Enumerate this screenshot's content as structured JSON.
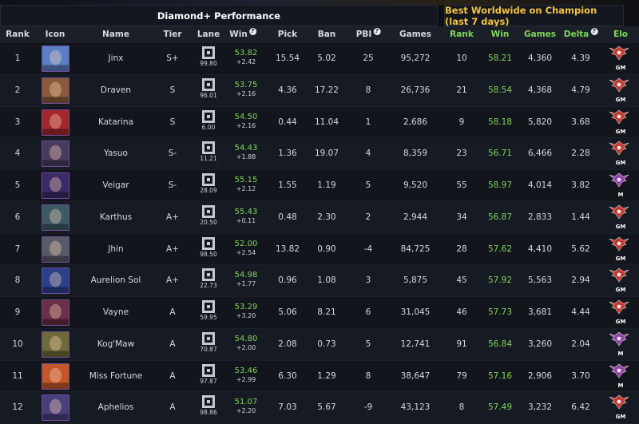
{
  "header": {
    "left_group": "Diamond+ Performance",
    "right_group": "Best Worldwide on Champion (last 7 days)"
  },
  "columns": {
    "rank": "Rank",
    "icon": "Icon",
    "name": "Name",
    "tier": "Tier",
    "lane": "Lane",
    "win": "Win",
    "pick": "Pick",
    "ban": "Ban",
    "pbi": "PBI",
    "games": "Games",
    "best_rank": "Rank",
    "best_win": "Win",
    "best_games": "Games",
    "delta": "Delta",
    "elo": "Elo"
  },
  "help_glyph": "?",
  "colors": {
    "accent_green": "#7fd65a",
    "gold": "#f4c542",
    "gm_red": "#c0392b",
    "m_purple": "#8e44ad"
  },
  "rows": [
    {
      "rank": "1",
      "name": "Jinx",
      "tier": "S+",
      "lane_val": "99.80",
      "win": "53.82",
      "win_delta": "+2.42",
      "pick": "15.54",
      "ban": "5.02",
      "pbi": "25",
      "games": "95,272",
      "best_rank": "10",
      "best_win": "58.21",
      "best_games": "4,360",
      "delta": "4.39",
      "elo": "GM",
      "portrait": "#5b7fc4"
    },
    {
      "rank": "2",
      "name": "Draven",
      "tier": "S",
      "lane_val": "96.01",
      "win": "53.75",
      "win_delta": "+2.16",
      "pick": "4.36",
      "ban": "17.22",
      "pbi": "8",
      "games": "26,736",
      "best_rank": "21",
      "best_win": "58.54",
      "best_games": "4,368",
      "delta": "4.79",
      "elo": "GM",
      "portrait": "#8a5a3a"
    },
    {
      "rank": "3",
      "name": "Katarina",
      "tier": "S",
      "lane_val": "6.00",
      "win": "54.50",
      "win_delta": "+2.16",
      "pick": "0.44",
      "ban": "11.04",
      "pbi": "1",
      "games": "2,686",
      "best_rank": "9",
      "best_win": "58.18",
      "best_games": "5,820",
      "delta": "3.68",
      "elo": "GM",
      "portrait": "#a3262a"
    },
    {
      "rank": "4",
      "name": "Yasuo",
      "tier": "S-",
      "lane_val": "11.21",
      "win": "54.43",
      "win_delta": "+1.88",
      "pick": "1.36",
      "ban": "19.07",
      "pbi": "4",
      "games": "8,359",
      "best_rank": "23",
      "best_win": "56.71",
      "best_games": "6,466",
      "delta": "2.28",
      "elo": "GM",
      "portrait": "#4a3b5e"
    },
    {
      "rank": "5",
      "name": "Veigar",
      "tier": "S-",
      "lane_val": "28.09",
      "win": "55.15",
      "win_delta": "+2.12",
      "pick": "1.55",
      "ban": "1.19",
      "pbi": "5",
      "games": "9,520",
      "best_rank": "55",
      "best_win": "58.97",
      "best_games": "4,014",
      "delta": "3.82",
      "elo": "M",
      "portrait": "#3b2a66"
    },
    {
      "rank": "6",
      "name": "Karthus",
      "tier": "A+",
      "lane_val": "20.50",
      "win": "55.43",
      "win_delta": "+0.11",
      "pick": "0.48",
      "ban": "2.30",
      "pbi": "2",
      "games": "2,944",
      "best_rank": "34",
      "best_win": "56.87",
      "best_games": "2,833",
      "delta": "1.44",
      "elo": "GM",
      "portrait": "#3d5963"
    },
    {
      "rank": "7",
      "name": "Jhin",
      "tier": "A+",
      "lane_val": "98.50",
      "win": "52.00",
      "win_delta": "+2.54",
      "pick": "13.82",
      "ban": "0.90",
      "pbi": "-4",
      "games": "84,725",
      "best_rank": "28",
      "best_win": "57.62",
      "best_games": "4,410",
      "delta": "5.62",
      "elo": "GM",
      "portrait": "#5a5a66"
    },
    {
      "rank": "8",
      "name": "Aurelion Sol",
      "tier": "A+",
      "lane_val": "22.73",
      "win": "54.98",
      "win_delta": "+1.77",
      "pick": "0.96",
      "ban": "1.08",
      "pbi": "3",
      "games": "5,875",
      "best_rank": "45",
      "best_win": "57.92",
      "best_games": "5,563",
      "delta": "2.94",
      "elo": "GM",
      "portrait": "#2c3f8a"
    },
    {
      "rank": "9",
      "name": "Vayne",
      "tier": "A",
      "lane_val": "59.95",
      "win": "53.29",
      "win_delta": "+3.20",
      "pick": "5.06",
      "ban": "8.21",
      "pbi": "6",
      "games": "31,045",
      "best_rank": "46",
      "best_win": "57.73",
      "best_games": "3,681",
      "delta": "4.44",
      "elo": "GM",
      "portrait": "#6b2f46"
    },
    {
      "rank": "10",
      "name": "Kog'Maw",
      "tier": "A",
      "lane_val": "70.87",
      "win": "54.80",
      "win_delta": "+2.00",
      "pick": "2.08",
      "ban": "0.73",
      "pbi": "5",
      "games": "12,741",
      "best_rank": "91",
      "best_win": "56.84",
      "best_games": "3,260",
      "delta": "2.04",
      "elo": "M",
      "portrait": "#6f6a3a"
    },
    {
      "rank": "11",
      "name": "Miss Fortune",
      "tier": "A",
      "lane_val": "97.87",
      "win": "53.46",
      "win_delta": "+2.99",
      "pick": "6.30",
      "ban": "1.29",
      "pbi": "8",
      "games": "38,647",
      "best_rank": "79",
      "best_win": "57.16",
      "best_games": "2,906",
      "delta": "3.70",
      "elo": "M",
      "portrait": "#c4562a"
    },
    {
      "rank": "12",
      "name": "Aphelios",
      "tier": "A",
      "lane_val": "98.86",
      "win": "51.07",
      "win_delta": "+2.20",
      "pick": "7.03",
      "ban": "5.67",
      "pbi": "-9",
      "games": "43,123",
      "best_rank": "8",
      "best_win": "57.49",
      "best_games": "3,232",
      "delta": "6.42",
      "elo": "GM",
      "portrait": "#4b3f7a"
    }
  ]
}
